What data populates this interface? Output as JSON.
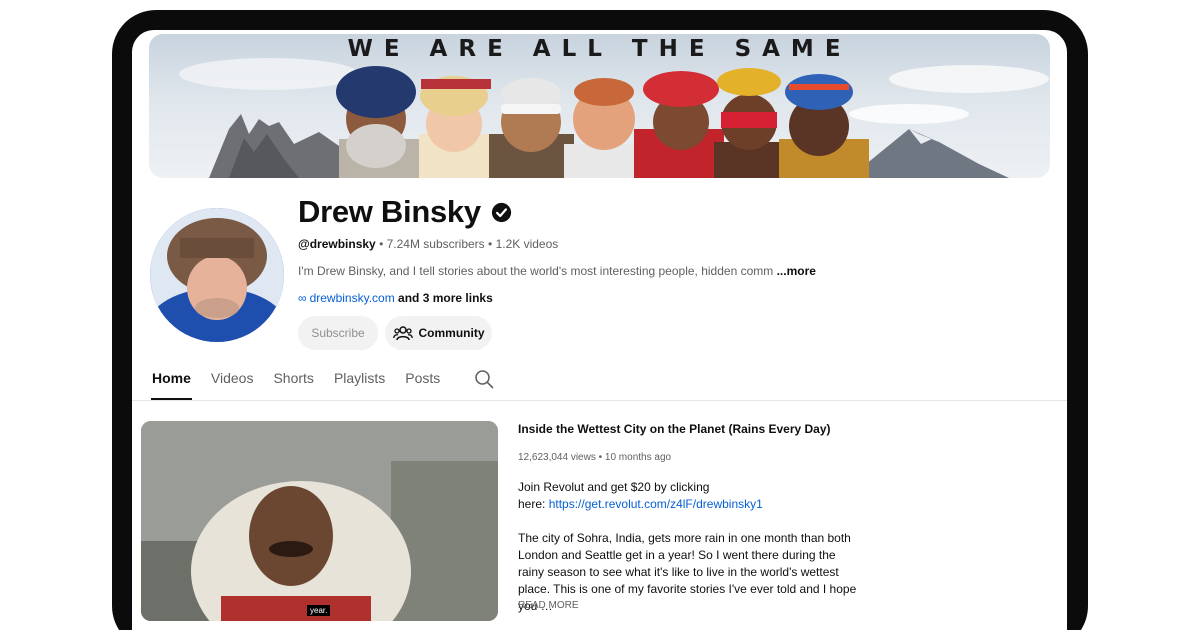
{
  "banner": {
    "title": "WE ARE ALL THE SAME"
  },
  "channel": {
    "name": "Drew Binsky",
    "handle": "@drewbinsky",
    "subscribers": "7.24M subscribers",
    "videos": "1.2K videos",
    "description": "I'm Drew Binsky, and I tell stories about the world's most interesting people, hidden comm",
    "more_label": "...more",
    "link": "drewbinsky.com",
    "more_links": "and 3 more links"
  },
  "buttons": {
    "subscribe": "Subscribe",
    "community": "Community"
  },
  "tabs": [
    {
      "label": "Home"
    },
    {
      "label": "Videos"
    },
    {
      "label": "Shorts"
    },
    {
      "label": "Playlists"
    },
    {
      "label": "Posts"
    }
  ],
  "featured": {
    "title": "Inside the Wettest City on the Planet (Rains Every Day)",
    "views": "12,623,044 views",
    "age": "10 months ago",
    "promo_line1": "Join Revolut and get $20 by clicking",
    "promo_here": "here:",
    "promo_link": "https://get.revolut.com/z4lF/drewbinsky1",
    "body": "The city of Sohra, India, gets more rain in one month than both London and Seattle get in a year! So I went there during the rainy season to see what it's like to live in the world's wettest place. This is one of my favorite stories I've ever told and I hope you …",
    "read_more": "READ MORE",
    "caption": "year."
  },
  "icons": {
    "verified": "verified-check-icon",
    "link": "link-icon",
    "community": "people-icon",
    "search": "search-icon"
  },
  "colors": {
    "link": "#065fd4",
    "text": "#0f0f0f",
    "muted": "#606060",
    "button_bg": "#f2f2f2"
  }
}
